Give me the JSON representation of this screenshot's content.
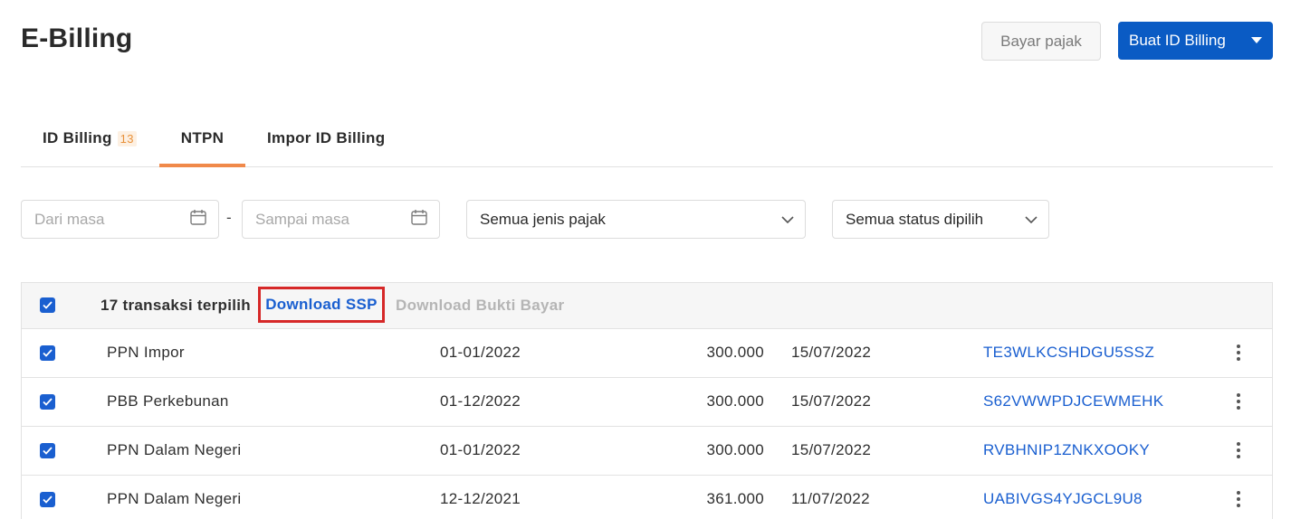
{
  "page": {
    "title": "E-Billing"
  },
  "header": {
    "pay_label": "Bayar pajak",
    "create_label": "Buat ID Billing"
  },
  "tabs": [
    {
      "label": "ID Billing",
      "badge": "13"
    },
    {
      "label": "NTPN"
    },
    {
      "label": "Impor ID Billing"
    }
  ],
  "filters": {
    "from_placeholder": "Dari masa",
    "separator": "-",
    "to_placeholder": "Sampai masa",
    "tax_type": "Semua jenis pajak",
    "status": "Semua status dipilih"
  },
  "table": {
    "selection_label": "17 transaksi terpilih",
    "download_ssp": "Download SSP",
    "download_bukti": "Download Bukti Bayar",
    "rows": [
      {
        "jenis": "PPN Impor",
        "masa": "01-01/2022",
        "nominal": "300.000",
        "tanggal": "15/07/2022",
        "ntpn": "TE3WLKCSHDGU5SSZ"
      },
      {
        "jenis": "PBB Perkebunan",
        "masa": "01-12/2022",
        "nominal": "300.000",
        "tanggal": "15/07/2022",
        "ntpn": "S62VWWPDJCEWMEHK"
      },
      {
        "jenis": "PPN Dalam Negeri",
        "masa": "01-01/2022",
        "nominal": "300.000",
        "tanggal": "15/07/2022",
        "ntpn": "RVBHNIP1ZNKXOOKY"
      },
      {
        "jenis": "PPN Dalam Negeri",
        "masa": "12-12/2021",
        "nominal": "361.000",
        "tanggal": "11/07/2022",
        "ntpn": "UABIVGS4YJGCL9U8"
      }
    ]
  },
  "colors": {
    "primary": "#0a5bc4",
    "accent": "#f0894a",
    "link": "#1a5fd0",
    "highlight": "#d62828"
  },
  "icons": [
    "calendar-icon",
    "chevron-down-icon",
    "caret-down-icon",
    "check-icon",
    "kebab-menu-icon"
  ]
}
